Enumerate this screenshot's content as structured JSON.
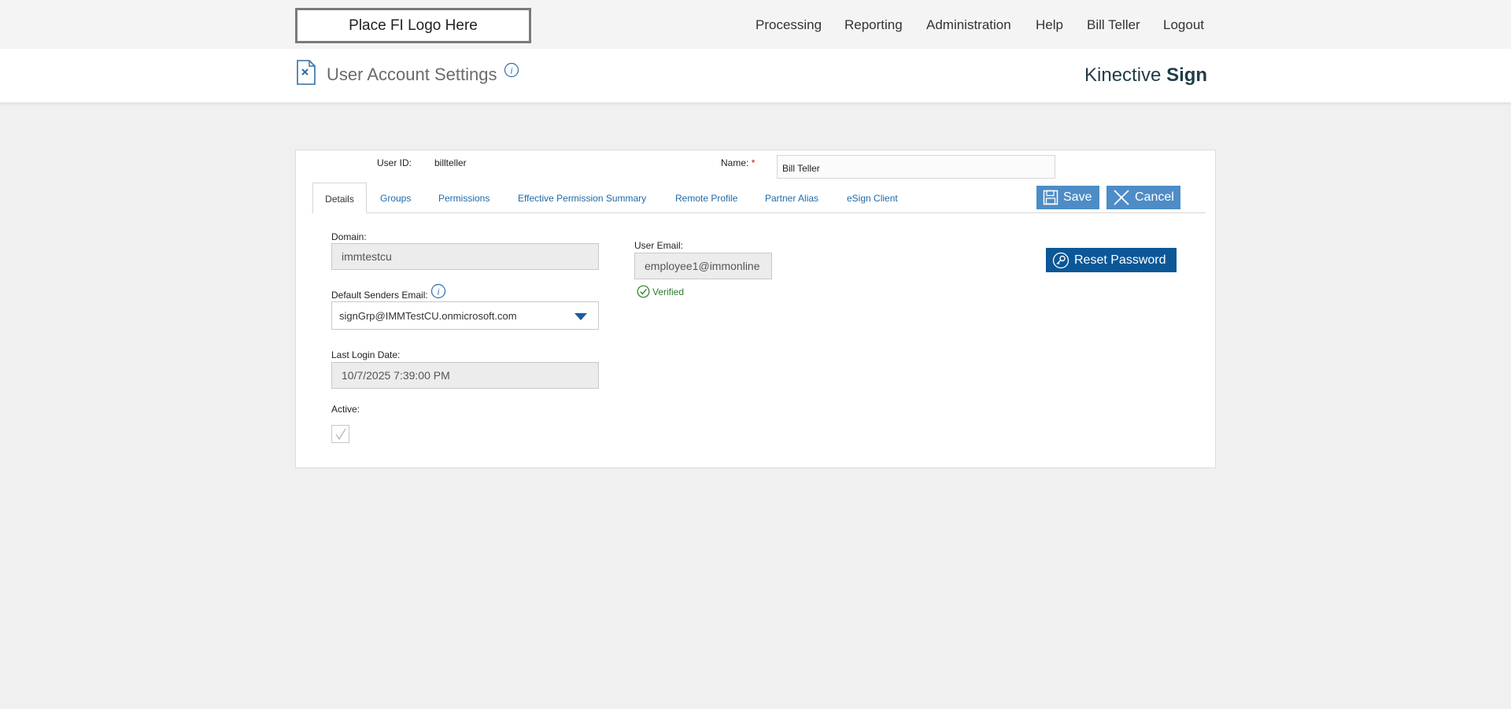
{
  "topbar": {
    "logo_text": "Place FI Logo Here",
    "nav": [
      "Processing",
      "Reporting",
      "Administration",
      "Help",
      "Bill Teller",
      "Logout"
    ]
  },
  "header": {
    "title": "User Account Settings",
    "brand_regular": "Kinective",
    "brand_bold": "Sign",
    "page_icon": "document-sign-icon",
    "info_icon": "info-icon"
  },
  "account": {
    "user_id_label": "User ID:",
    "user_id_value": "billteller",
    "name_label": "Name:",
    "name_required_mark": "*",
    "name_value": "Bill Teller"
  },
  "tabs": [
    "Details",
    "Groups",
    "Permissions",
    "Effective Permission Summary",
    "Remote Profile",
    "Partner Alias",
    "eSign Client"
  ],
  "active_tab": "Details",
  "buttons": {
    "save": "Save",
    "cancel": "Cancel",
    "reset_password": "Reset Password"
  },
  "details": {
    "domain_label": "Domain:",
    "domain_value": "immtestcu",
    "default_senders_email_label": "Default Senders Email:",
    "default_senders_email_value": "signGrp@IMMTestCU.onmicrosoft.com",
    "last_login_label": "Last Login Date:",
    "last_login_value": "10/7/2025 7:39:00 PM",
    "active_label": "Active:",
    "active_checked": true,
    "user_email_label": "User Email:",
    "user_email_value": "employee1@immonline",
    "verified_text": "Verified"
  },
  "colors": {
    "link_blue": "#1e6aa8",
    "button_blue": "#4d8cc6",
    "button_dark_blue": "#0b5797",
    "verified_green": "#2a7d2a",
    "required_red": "#d01010"
  }
}
